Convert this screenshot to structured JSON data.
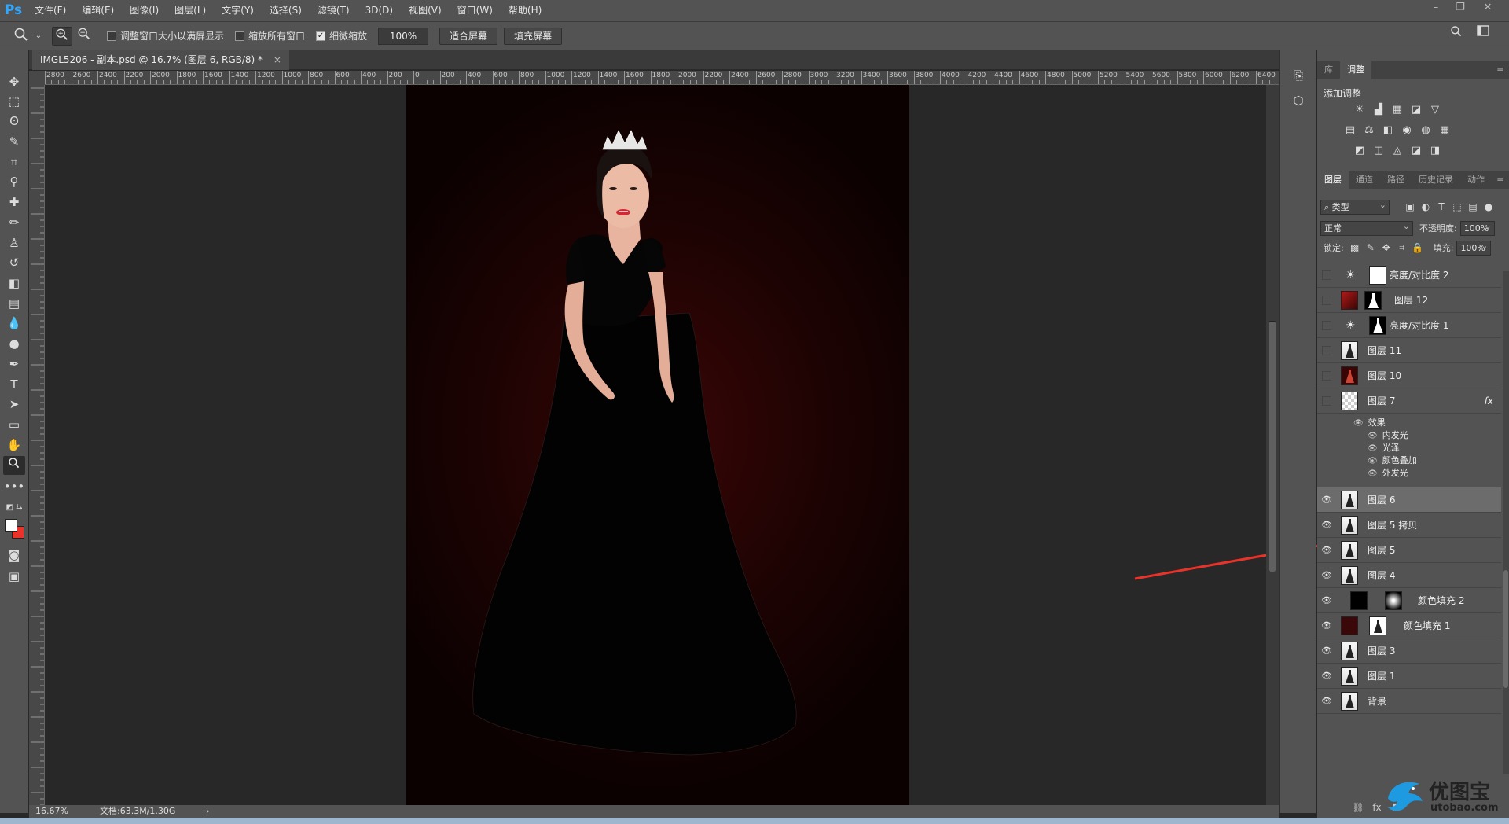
{
  "app": {
    "logo": "Ps"
  },
  "menu": [
    "文件(F)",
    "编辑(E)",
    "图像(I)",
    "图层(L)",
    "文字(Y)",
    "选择(S)",
    "滤镜(T)",
    "3D(D)",
    "视图(V)",
    "窗口(W)",
    "帮助(H)"
  ],
  "window_controls": {
    "minimize": "–",
    "restore": "❐",
    "close": "✕"
  },
  "options": {
    "resize_windows_label": "调整窗口大小以满屏显示",
    "zoom_all_label": "缩放所有窗口",
    "scrubby_label": "细微缩放",
    "scrubby_checked": true,
    "zoom_value": "100%",
    "fit_screen": "适合屏幕",
    "fill_screen": "填充屏幕"
  },
  "document": {
    "tab_title": "IMGL5206 - 副本.psd @ 16.7% (图层 6, RGB/8) *",
    "close": "×"
  },
  "ruler_labels": [
    "2800",
    "2600",
    "2400",
    "2200",
    "2000",
    "1800",
    "1600",
    "1400",
    "1200",
    "1000",
    "800",
    "600",
    "400",
    "200",
    "0",
    "200",
    "400",
    "600",
    "800",
    "1000",
    "1200",
    "1400",
    "1600",
    "1800",
    "2000",
    "2200",
    "2400",
    "2600",
    "2800",
    "3000",
    "3200",
    "3400",
    "3600",
    "3800",
    "4000",
    "4200",
    "4400",
    "4600",
    "4800",
    "5000",
    "5200",
    "5400",
    "5600",
    "5800",
    "6000",
    "6200",
    "6400"
  ],
  "status": {
    "zoom": "16.67%",
    "doc": "文档:63.3M/1.30G",
    "arrow": "›"
  },
  "adjust_panel": {
    "tabs": [
      "库",
      "调整"
    ],
    "active_tab": "调整",
    "title": "添加调整",
    "icons_row1": [
      "☀",
      "▟",
      "▦",
      "◪",
      "▽"
    ],
    "icons_row2": [
      "▤",
      "⚖",
      "◧",
      "◉",
      "◍",
      "▦"
    ],
    "icons_row3": [
      "◩",
      "◫",
      "◬",
      "◪",
      "◨"
    ]
  },
  "layers_panel": {
    "tabs": [
      "图层",
      "通道",
      "路径",
      "历史记录",
      "动作"
    ],
    "active_tab": "图层",
    "filter_label": "类型",
    "blend_mode": "正常",
    "opacity_label": "不透明度:",
    "opacity_value": "100%",
    "lock_label": "锁定:",
    "fill_label": "填充:",
    "fill_value": "100%",
    "layers": [
      {
        "name": "亮度/对比度 2",
        "visible": false,
        "selected": false,
        "type": "adjustment"
      },
      {
        "name": "图层 12",
        "visible": false,
        "selected": false,
        "type": "masked"
      },
      {
        "name": "亮度/对比度 1",
        "visible": false,
        "selected": false,
        "type": "adjustment"
      },
      {
        "name": "图层 11",
        "visible": false,
        "selected": false,
        "type": "photo"
      },
      {
        "name": "图层 10",
        "visible": false,
        "selected": false,
        "type": "photo-dark"
      },
      {
        "name": "图层 7",
        "visible": false,
        "selected": false,
        "type": "transparent",
        "fx": "fx"
      },
      {
        "name": "图层 6",
        "visible": true,
        "selected": true,
        "type": "photo"
      },
      {
        "name": "图层 5 拷贝",
        "visible": true,
        "selected": false,
        "type": "photo"
      },
      {
        "name": "图层 5",
        "visible": true,
        "selected": false,
        "type": "photo"
      },
      {
        "name": "图层 4",
        "visible": true,
        "selected": false,
        "type": "photo"
      },
      {
        "name": "颜色填充 2",
        "visible": true,
        "selected": false,
        "type": "fill-black"
      },
      {
        "name": "颜色填充 1",
        "visible": true,
        "selected": false,
        "type": "fill-red"
      },
      {
        "name": "图层 3",
        "visible": true,
        "selected": false,
        "type": "photo"
      },
      {
        "name": "图层 1",
        "visible": true,
        "selected": false,
        "type": "photo"
      },
      {
        "name": "背景",
        "visible": true,
        "selected": false,
        "type": "photo"
      }
    ],
    "effects_title": "效果",
    "effects": [
      "内发光",
      "光泽",
      "颜色叠加",
      "外发光"
    ]
  },
  "watermark": {
    "text": "优图宝",
    "url": "utobao.com"
  },
  "colors": {
    "accent": "#31a8ff",
    "arrow": "#e8322a",
    "canvas_bg": "#1e0303"
  }
}
